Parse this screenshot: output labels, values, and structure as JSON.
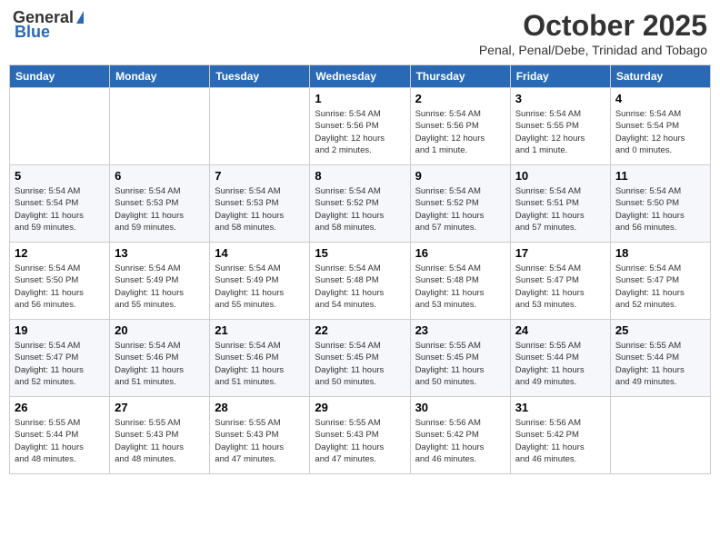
{
  "logo": {
    "general": "General",
    "blue": "Blue"
  },
  "header": {
    "month": "October 2025",
    "location": "Penal, Penal/Debe, Trinidad and Tobago"
  },
  "weekdays": [
    "Sunday",
    "Monday",
    "Tuesday",
    "Wednesday",
    "Thursday",
    "Friday",
    "Saturday"
  ],
  "weeks": [
    [
      {
        "day": "",
        "info": ""
      },
      {
        "day": "",
        "info": ""
      },
      {
        "day": "",
        "info": ""
      },
      {
        "day": "1",
        "info": "Sunrise: 5:54 AM\nSunset: 5:56 PM\nDaylight: 12 hours\nand 2 minutes."
      },
      {
        "day": "2",
        "info": "Sunrise: 5:54 AM\nSunset: 5:56 PM\nDaylight: 12 hours\nand 1 minute."
      },
      {
        "day": "3",
        "info": "Sunrise: 5:54 AM\nSunset: 5:55 PM\nDaylight: 12 hours\nand 1 minute."
      },
      {
        "day": "4",
        "info": "Sunrise: 5:54 AM\nSunset: 5:54 PM\nDaylight: 12 hours\nand 0 minutes."
      }
    ],
    [
      {
        "day": "5",
        "info": "Sunrise: 5:54 AM\nSunset: 5:54 PM\nDaylight: 11 hours\nand 59 minutes."
      },
      {
        "day": "6",
        "info": "Sunrise: 5:54 AM\nSunset: 5:53 PM\nDaylight: 11 hours\nand 59 minutes."
      },
      {
        "day": "7",
        "info": "Sunrise: 5:54 AM\nSunset: 5:53 PM\nDaylight: 11 hours\nand 58 minutes."
      },
      {
        "day": "8",
        "info": "Sunrise: 5:54 AM\nSunset: 5:52 PM\nDaylight: 11 hours\nand 58 minutes."
      },
      {
        "day": "9",
        "info": "Sunrise: 5:54 AM\nSunset: 5:52 PM\nDaylight: 11 hours\nand 57 minutes."
      },
      {
        "day": "10",
        "info": "Sunrise: 5:54 AM\nSunset: 5:51 PM\nDaylight: 11 hours\nand 57 minutes."
      },
      {
        "day": "11",
        "info": "Sunrise: 5:54 AM\nSunset: 5:50 PM\nDaylight: 11 hours\nand 56 minutes."
      }
    ],
    [
      {
        "day": "12",
        "info": "Sunrise: 5:54 AM\nSunset: 5:50 PM\nDaylight: 11 hours\nand 56 minutes."
      },
      {
        "day": "13",
        "info": "Sunrise: 5:54 AM\nSunset: 5:49 PM\nDaylight: 11 hours\nand 55 minutes."
      },
      {
        "day": "14",
        "info": "Sunrise: 5:54 AM\nSunset: 5:49 PM\nDaylight: 11 hours\nand 55 minutes."
      },
      {
        "day": "15",
        "info": "Sunrise: 5:54 AM\nSunset: 5:48 PM\nDaylight: 11 hours\nand 54 minutes."
      },
      {
        "day": "16",
        "info": "Sunrise: 5:54 AM\nSunset: 5:48 PM\nDaylight: 11 hours\nand 53 minutes."
      },
      {
        "day": "17",
        "info": "Sunrise: 5:54 AM\nSunset: 5:47 PM\nDaylight: 11 hours\nand 53 minutes."
      },
      {
        "day": "18",
        "info": "Sunrise: 5:54 AM\nSunset: 5:47 PM\nDaylight: 11 hours\nand 52 minutes."
      }
    ],
    [
      {
        "day": "19",
        "info": "Sunrise: 5:54 AM\nSunset: 5:47 PM\nDaylight: 11 hours\nand 52 minutes."
      },
      {
        "day": "20",
        "info": "Sunrise: 5:54 AM\nSunset: 5:46 PM\nDaylight: 11 hours\nand 51 minutes."
      },
      {
        "day": "21",
        "info": "Sunrise: 5:54 AM\nSunset: 5:46 PM\nDaylight: 11 hours\nand 51 minutes."
      },
      {
        "day": "22",
        "info": "Sunrise: 5:54 AM\nSunset: 5:45 PM\nDaylight: 11 hours\nand 50 minutes."
      },
      {
        "day": "23",
        "info": "Sunrise: 5:55 AM\nSunset: 5:45 PM\nDaylight: 11 hours\nand 50 minutes."
      },
      {
        "day": "24",
        "info": "Sunrise: 5:55 AM\nSunset: 5:44 PM\nDaylight: 11 hours\nand 49 minutes."
      },
      {
        "day": "25",
        "info": "Sunrise: 5:55 AM\nSunset: 5:44 PM\nDaylight: 11 hours\nand 49 minutes."
      }
    ],
    [
      {
        "day": "26",
        "info": "Sunrise: 5:55 AM\nSunset: 5:44 PM\nDaylight: 11 hours\nand 48 minutes."
      },
      {
        "day": "27",
        "info": "Sunrise: 5:55 AM\nSunset: 5:43 PM\nDaylight: 11 hours\nand 48 minutes."
      },
      {
        "day": "28",
        "info": "Sunrise: 5:55 AM\nSunset: 5:43 PM\nDaylight: 11 hours\nand 47 minutes."
      },
      {
        "day": "29",
        "info": "Sunrise: 5:55 AM\nSunset: 5:43 PM\nDaylight: 11 hours\nand 47 minutes."
      },
      {
        "day": "30",
        "info": "Sunrise: 5:56 AM\nSunset: 5:42 PM\nDaylight: 11 hours\nand 46 minutes."
      },
      {
        "day": "31",
        "info": "Sunrise: 5:56 AM\nSunset: 5:42 PM\nDaylight: 11 hours\nand 46 minutes."
      },
      {
        "day": "",
        "info": ""
      }
    ]
  ]
}
